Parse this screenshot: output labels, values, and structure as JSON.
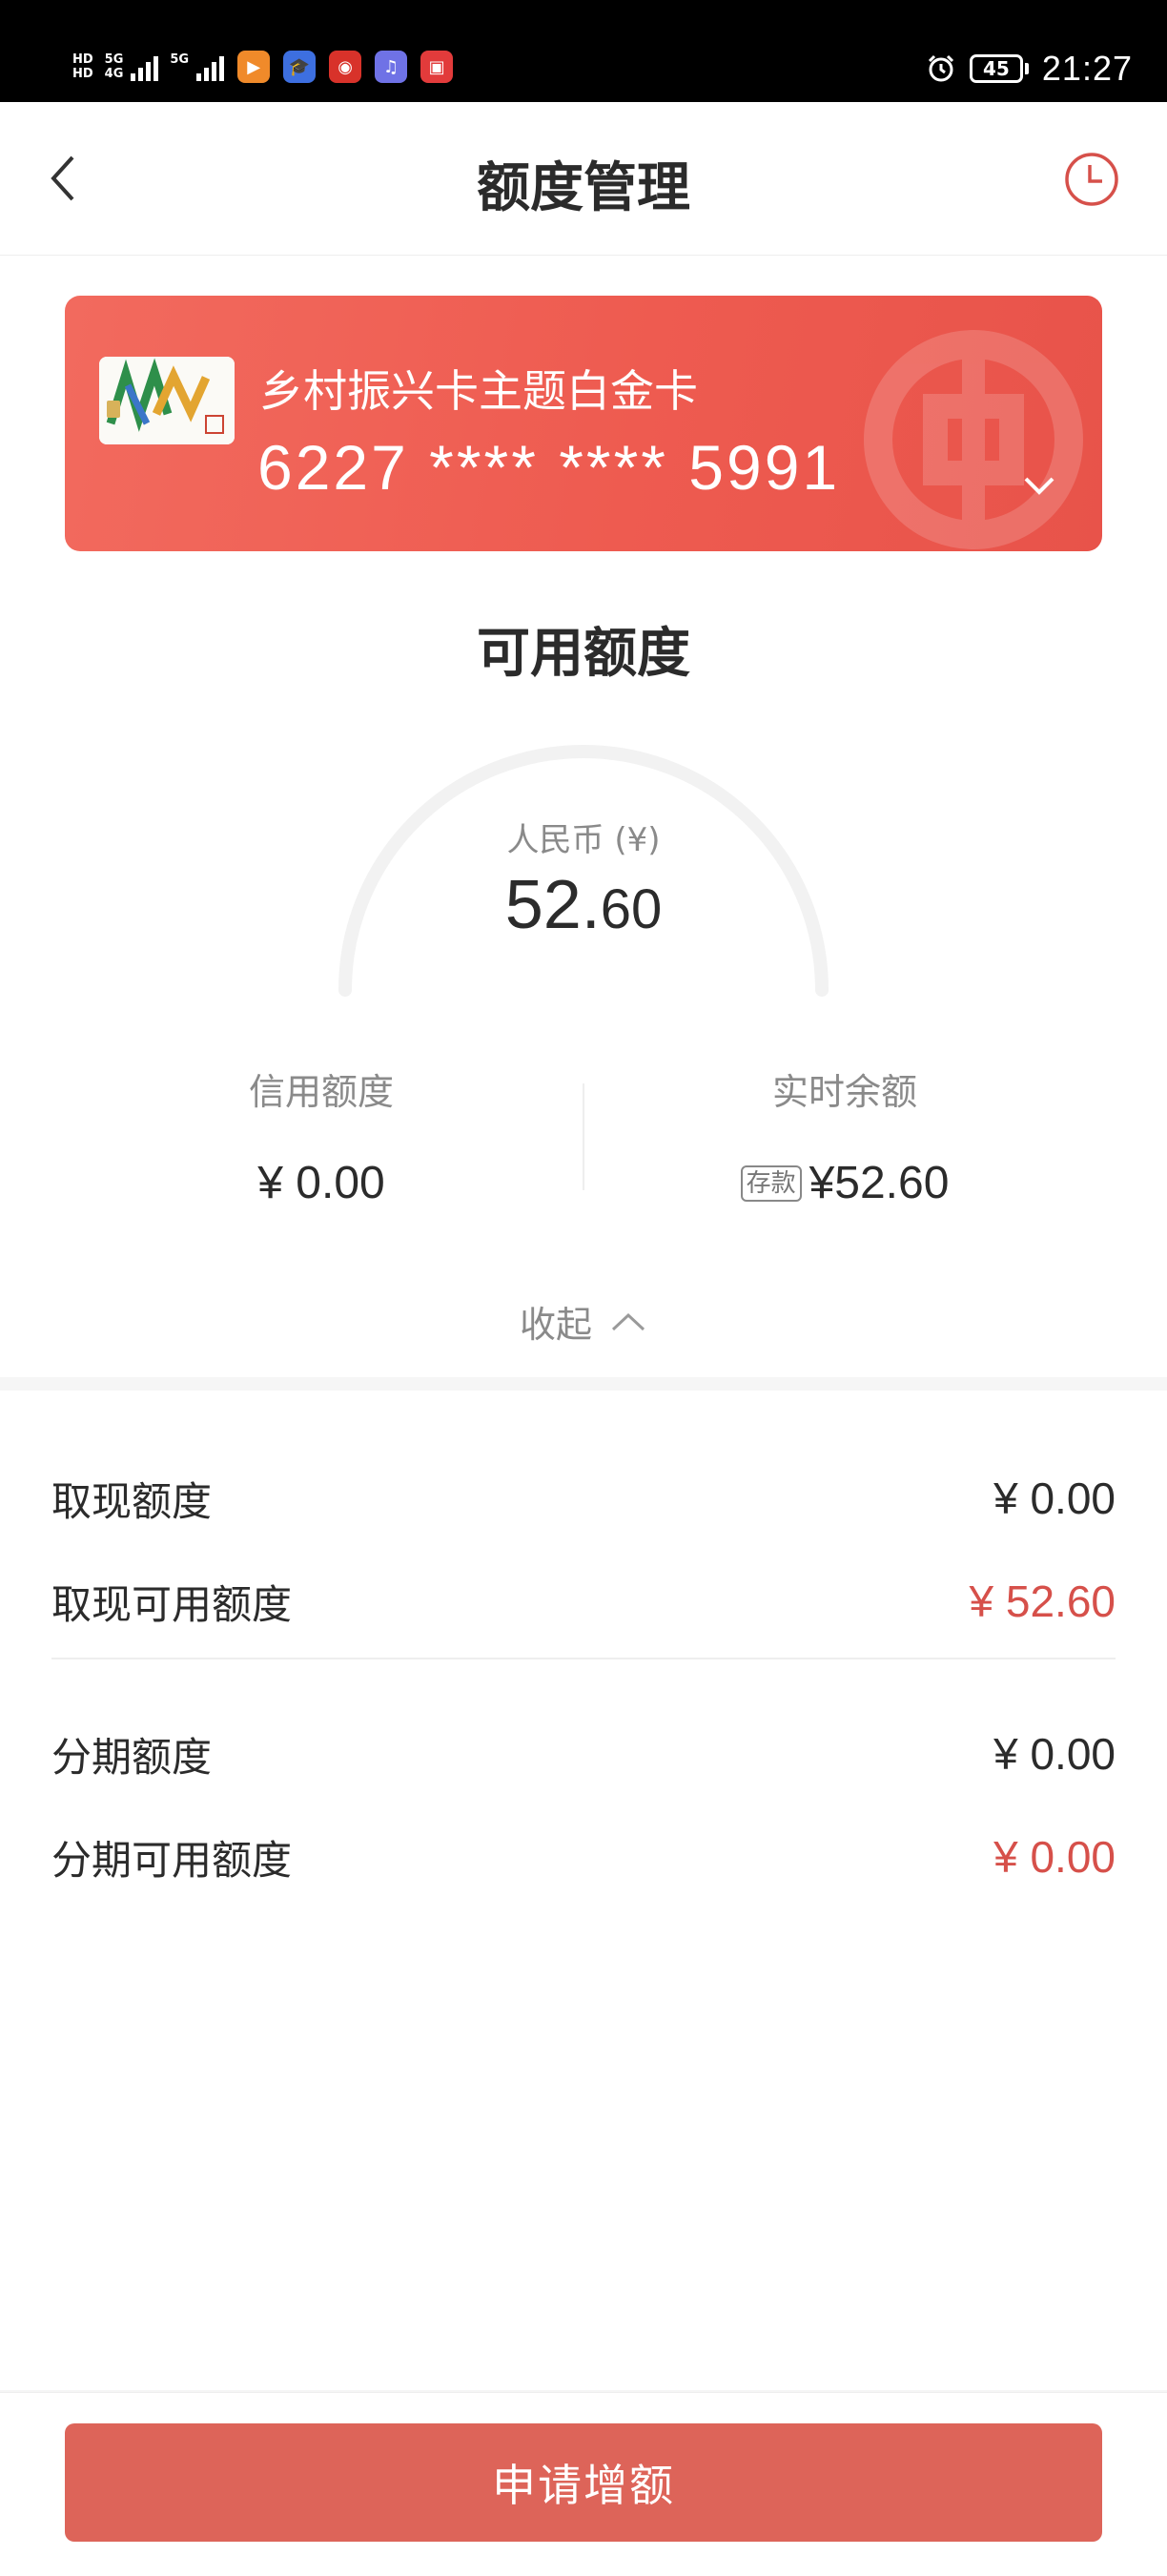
{
  "status_bar": {
    "hd_labels": [
      "HD",
      "HD"
    ],
    "network": [
      "5G",
      "4G"
    ],
    "network2": "5G",
    "battery": "45",
    "time": "21:27",
    "app_icons": [
      {
        "name": "video-app-icon",
        "color": "#f08a2a"
      },
      {
        "name": "education-app-icon",
        "color": "#3d6fe0"
      },
      {
        "name": "bank-app-icon",
        "color": "#d8322a"
      },
      {
        "name": "music-app-icon",
        "color": "#6f72e6"
      },
      {
        "name": "reader-app-icon",
        "color": "#e23b3b"
      }
    ]
  },
  "header": {
    "title": "额度管理",
    "back_icon": "chevron-left-icon",
    "history_icon": "clock-icon"
  },
  "card": {
    "name": "乡村振兴卡主题白金卡",
    "number": "6227 **** **** 5991",
    "color": "#ee5b50"
  },
  "available": {
    "title": "可用额度",
    "currency_label": "人民币 (¥)",
    "amount_int": "52.",
    "amount_dec": "60"
  },
  "stats": {
    "credit_limit_label": "信用额度",
    "credit_limit_value": "¥ 0.00",
    "balance_label": "实时余额",
    "deposit_tag": "存款",
    "balance_value": "¥52.60"
  },
  "collapse_label": "收起",
  "details": [
    {
      "label": "取现额度",
      "value": "¥ 0.00",
      "highlight": false
    },
    {
      "label": "取现可用额度",
      "value": "¥ 52.60",
      "highlight": true
    },
    {
      "label": "分期额度",
      "value": "¥ 0.00",
      "highlight": false
    },
    {
      "label": "分期可用额度",
      "value": "¥ 0.00",
      "highlight": true
    }
  ],
  "apply_button": "申请增额",
  "colors": {
    "accent_red": "#d6504a",
    "button_red": "#dd6459"
  }
}
